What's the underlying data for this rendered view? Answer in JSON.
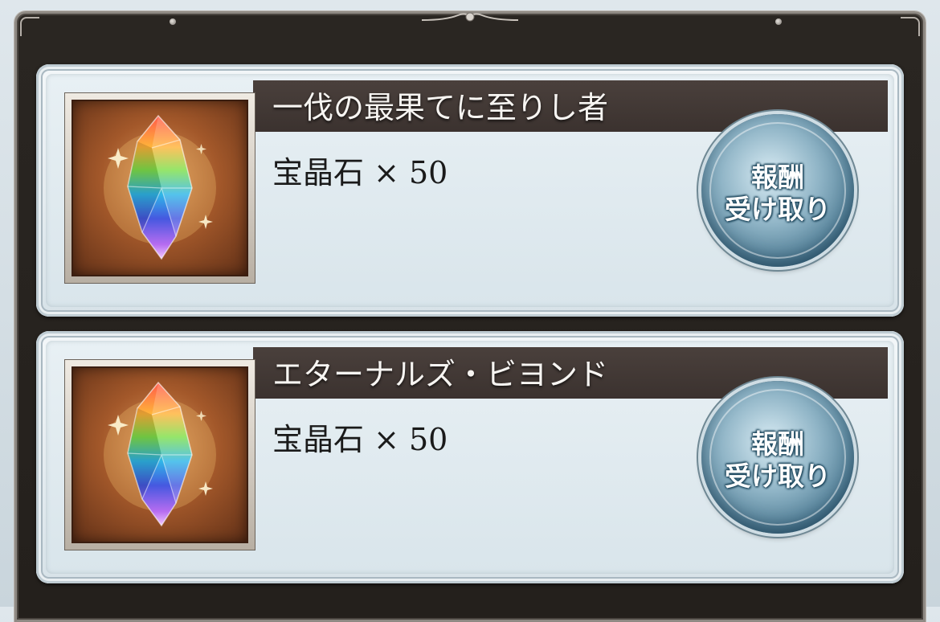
{
  "rewards": [
    {
      "title": "一伐の最果てに至りし者",
      "item": "宝晶石 × 50",
      "item_icon": "rainbow-crystal-icon",
      "claim_line1": "報酬",
      "claim_line2": "受け取り"
    },
    {
      "title": "エターナルズ・ビヨンド",
      "item": "宝晶石 × 50",
      "item_icon": "rainbow-crystal-icon",
      "claim_line1": "報酬",
      "claim_line2": "受け取り"
    }
  ],
  "colors": {
    "frame": "#2a2622",
    "title_band": "#4a403c",
    "button": "#3f6f89"
  }
}
